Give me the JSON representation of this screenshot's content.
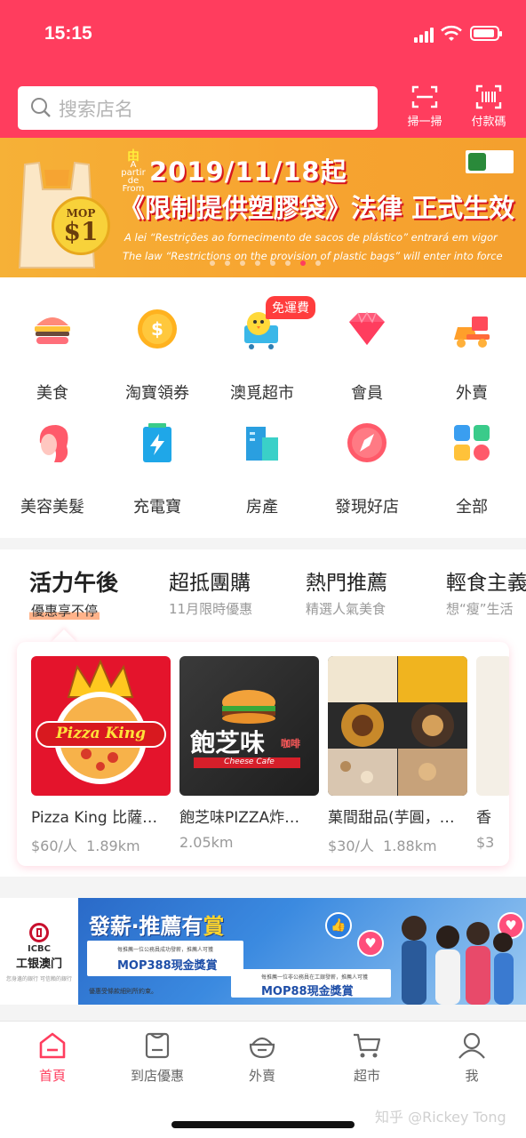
{
  "status_bar": {
    "time": "15:15"
  },
  "search": {
    "placeholder": "搜索店名"
  },
  "header_actions": [
    {
      "label": "掃一掃",
      "icon": "scan-icon"
    },
    {
      "label": "付款碼",
      "icon": "barcode-icon"
    }
  ],
  "banner": {
    "from_small": "A partir de",
    "from_char": "由",
    "from_en": "From",
    "date_line": "2019/11/18起",
    "headline": "《限制提供塑膠袋》法律 正式生效",
    "pt_line": "A lei “Restrições ao fornecimento de sacos de plástico” entrará em vigor",
    "en_line": "The law “Restrictions on the provision of plastic bags” will enter into force",
    "mop_label": "MOP",
    "mop_value": "$1",
    "page_count": 8,
    "active_page": 6
  },
  "categories": [
    {
      "label": "美食",
      "icon": "burger-icon"
    },
    {
      "label": "淘寶領券",
      "icon": "coin-icon"
    },
    {
      "label": "澳覓超市",
      "icon": "chick-cart-icon",
      "badge": "免運費"
    },
    {
      "label": "會員",
      "icon": "diamond-icon"
    },
    {
      "label": "外賣",
      "icon": "delivery-truck-icon"
    },
    {
      "label": "美容美髮",
      "icon": "woman-hair-icon"
    },
    {
      "label": "充電寶",
      "icon": "power-bank-icon"
    },
    {
      "label": "房產",
      "icon": "buildings-icon"
    },
    {
      "label": "發現好店",
      "icon": "compass-icon"
    },
    {
      "label": "全部",
      "icon": "grid-icon"
    }
  ],
  "promo_tabs": [
    {
      "title": "活力午後",
      "subtitle": "優惠享不停",
      "active": true
    },
    {
      "title": "超抵團購",
      "subtitle": "11月限時優惠",
      "active": false
    },
    {
      "title": "熱門推薦",
      "subtitle": "精選人氣美食",
      "active": false
    },
    {
      "title": "輕食主義",
      "subtitle": "想“瘦”生活",
      "active": false
    }
  ],
  "shops": [
    {
      "name": "Pizza King 比薩…",
      "price": "$60/人",
      "distance": "1.89km",
      "logo_text": "Pizza King"
    },
    {
      "name": "飽芝味PIZZA炸…",
      "price": "",
      "distance": "2.05km",
      "logo_text": "飽芝味",
      "logo_sub": "Cheese Cafe",
      "logo_tag": "咖啡"
    },
    {
      "name": "菓間甜品(芋圓，…",
      "price": "$30/人",
      "distance": "1.88km"
    },
    {
      "name": "香",
      "price": "$3",
      "distance": ""
    }
  ],
  "ad": {
    "bank_en": "ICBC",
    "bank_cn": "工银澳门",
    "bank_tagline": "您身邊的銀行 可信賴的銀行",
    "title_a": "發薪‧推薦有",
    "title_b": "賞",
    "slip1_small": "每推薦一位公務員成功發薪，推薦人可獲",
    "slip1_big": "MOP388現金獎賞",
    "slip2_small": "每推薦一位非公務員在工銀發薪，推薦人可獲",
    "slip2_big": "MOP88現金獎賞",
    "note": "優惠受條款細則所約束。"
  },
  "tabbar": [
    {
      "label": "首頁",
      "icon": "home-icon",
      "active": true
    },
    {
      "label": "到店優惠",
      "icon": "coupon-icon",
      "active": false
    },
    {
      "label": "外賣",
      "icon": "takeout-bowl-icon",
      "active": false
    },
    {
      "label": "超市",
      "icon": "cart-icon",
      "active": false
    },
    {
      "label": "我",
      "icon": "user-icon",
      "active": false
    }
  ],
  "watermark": "知乎 @Rickey Tong",
  "colors": {
    "brand": "#ff3d5e",
    "banner": "#f7a430"
  }
}
